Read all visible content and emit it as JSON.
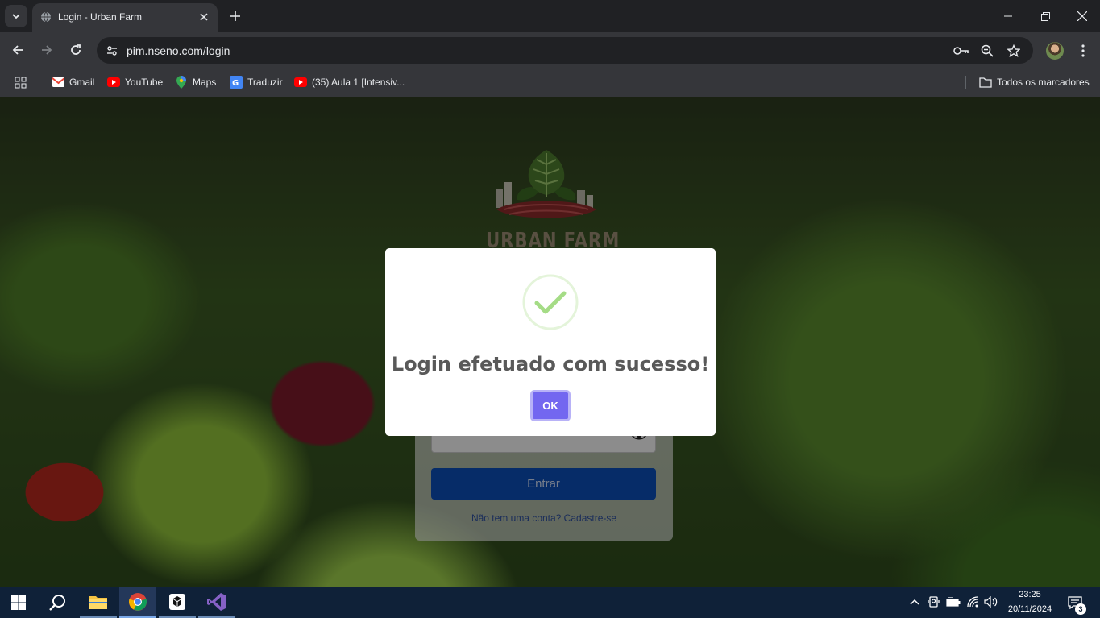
{
  "browser": {
    "tab_title": "Login - Urban Farm",
    "url": "pim.nseno.com/login",
    "bookmarks": [
      {
        "label": "Gmail",
        "icon": "gmail-icon"
      },
      {
        "label": "YouTube",
        "icon": "youtube-icon"
      },
      {
        "label": "Maps",
        "icon": "maps-icon"
      },
      {
        "label": "Traduzir",
        "icon": "translate-icon"
      },
      {
        "label": "(35) Aula 1 [Intensiv...",
        "icon": "youtube-icon"
      }
    ],
    "all_bookmarks_label": "Todos os marcadores"
  },
  "page": {
    "logo_text": "URBAN FARM",
    "password_mask": "•••",
    "enter_label": "Entrar",
    "signup_link": "Não tem uma conta? Cadastre-se"
  },
  "dialog": {
    "title": "Login efetuado com sucesso!",
    "ok_label": "OK",
    "accent_color": "#7367f0",
    "success_color": "#a5dc86"
  },
  "taskbar": {
    "apps": [
      "start-icon",
      "search-icon",
      "file-explorer-icon",
      "chrome-icon",
      "terminal-icon",
      "visual-studio-icon"
    ],
    "time": "23:25",
    "date": "20/11/2024",
    "notification_count": "3"
  }
}
